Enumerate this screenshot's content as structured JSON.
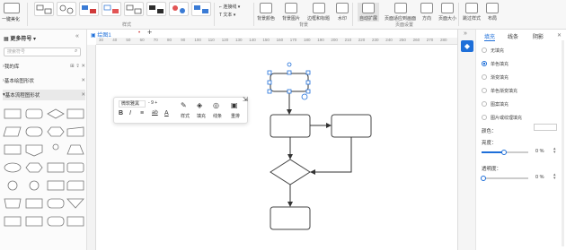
{
  "ribbon": {
    "paste_label": "一键美化",
    "style_group_label": "样式",
    "connector_label": "连接线",
    "text_label": "文本",
    "page_buttons": [
      "背景颜色",
      "背景图片",
      "边框和标题",
      "水印"
    ],
    "page_group_label": "背景",
    "view_buttons": [
      "自动扩展",
      "页面适应到画面",
      "方向",
      "页面大小"
    ],
    "view_group_label": "页面设置",
    "extra_buttons": [
      "跳过样式",
      "布局"
    ]
  },
  "left_panel": {
    "title": "更多符号",
    "search_placeholder": "搜索符号",
    "libraries": [
      {
        "label": "我的库"
      },
      {
        "label": "基本绘图形状"
      },
      {
        "label": "基本流程图形状"
      }
    ]
  },
  "tabs": {
    "active_tab": "绘图1",
    "add_label": "+"
  },
  "ruler_ticks": [
    "30",
    "40",
    "50",
    "60",
    "70",
    "80",
    "90",
    "100",
    "110",
    "120",
    "130",
    "140",
    "150",
    "160",
    "170",
    "180",
    "190",
    "200",
    "210",
    "220",
    "230",
    "240",
    "250",
    "260",
    "270",
    "280"
  ],
  "float_toolbar": {
    "font_name": "微软雅黑",
    "font_size": "9",
    "bold": "B",
    "italic": "I",
    "actions": [
      "样式",
      "填充",
      "线条",
      "重排"
    ]
  },
  "right_panel": {
    "tabs": [
      "填充",
      "线条",
      "阴影"
    ],
    "fill_options": [
      "无填充",
      "单色填充",
      "渐变填充",
      "单色渐变填充",
      "图案填充",
      "图片或纹理填充"
    ],
    "selected_fill": 1,
    "color_label": "颜色：",
    "brightness_label": "亮度：",
    "brightness_value": "0 %",
    "transparency_label": "透明度：",
    "transparency_value": "0 %",
    "accent_color": "#1e6fd9"
  }
}
